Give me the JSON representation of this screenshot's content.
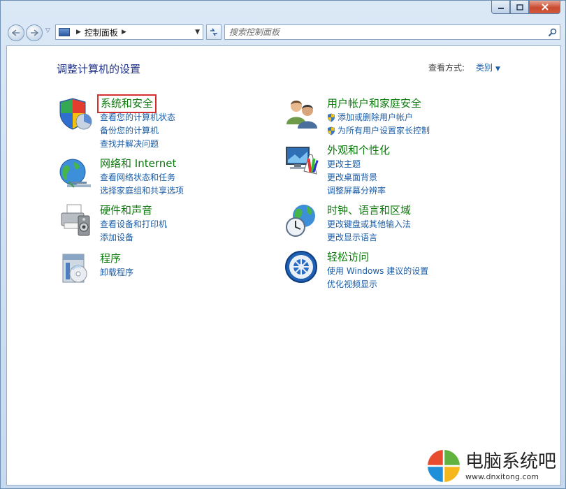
{
  "address_bar": {
    "path": "控制面板"
  },
  "search": {
    "placeholder": "搜索控制面板"
  },
  "header": {
    "title": "调整计算机的设置",
    "view_label": "查看方式:",
    "view_value": "类别"
  },
  "categories": [
    {
      "title": "系统和安全",
      "links": [
        "查看您的计算机状态",
        "备份您的计算机",
        "查找并解决问题"
      ]
    },
    {
      "title": "网络和 Internet",
      "links": [
        "查看网络状态和任务",
        "选择家庭组和共享选项"
      ]
    },
    {
      "title": "硬件和声音",
      "links": [
        "查看设备和打印机",
        "添加设备"
      ]
    },
    {
      "title": "程序",
      "links": [
        "卸载程序"
      ]
    },
    {
      "title": "用户帐户和家庭安全",
      "links": [
        "添加或删除用户帐户",
        "为所有用户设置家长控制"
      ]
    },
    {
      "title": "外观和个性化",
      "links": [
        "更改主题",
        "更改桌面背景",
        "调整屏幕分辨率"
      ]
    },
    {
      "title": "时钟、语言和区域",
      "links": [
        "更改键盘或其他输入法",
        "更改显示语言"
      ]
    },
    {
      "title": "轻松访问",
      "links": [
        "使用 Windows 建议的设置",
        "优化视频显示"
      ]
    }
  ],
  "watermark": {
    "title": "电脑系统吧",
    "url": "www.dnxitong.com"
  },
  "colors": {
    "category_title": "#0d7a0d",
    "link": "#1c5ea8",
    "page_title": "#1e3287",
    "highlight_box": "#d72f2f"
  }
}
